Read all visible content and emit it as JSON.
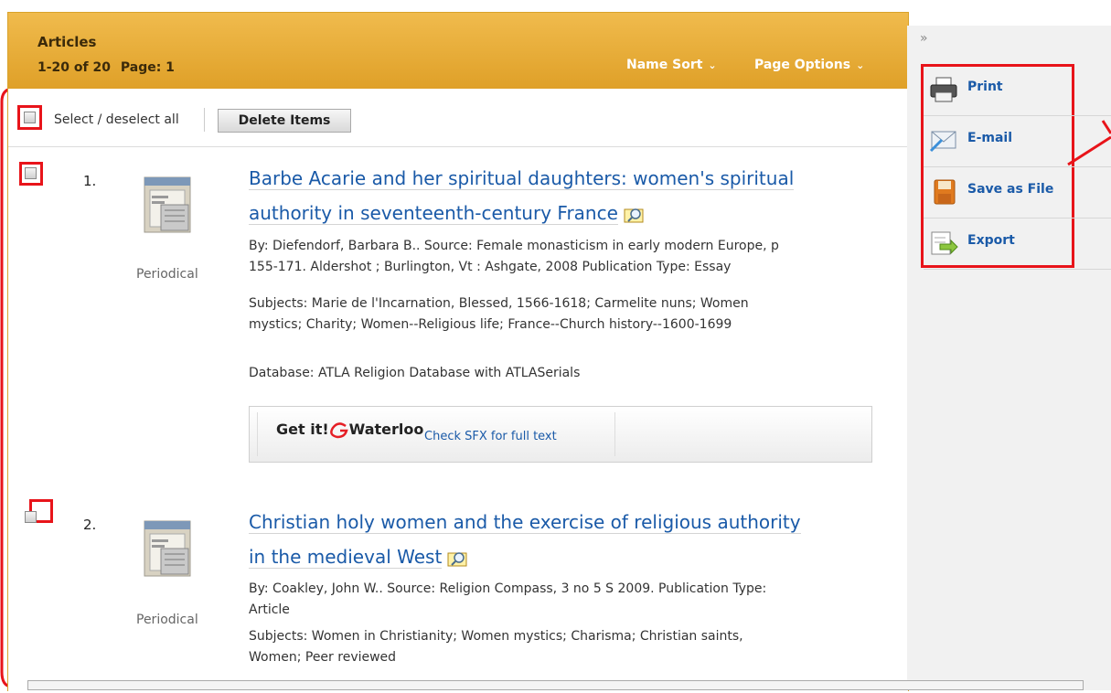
{
  "header": {
    "title": "Articles",
    "range": "1-20 of 20",
    "page": "Page: 1",
    "name_sort": "Name Sort",
    "page_options": "Page Options"
  },
  "toolbar": {
    "select_all": "Select / deselect all",
    "delete_label": "Delete Items"
  },
  "results": [
    {
      "number": "1.",
      "type": "Periodical",
      "title_lines": [
        "Barbe Acarie and her spiritual daughters: women's spiritual",
        "authority in seventeenth-century France"
      ],
      "meta_lines": [
        "By: Diefendorf, Barbara B.. Source: Female monasticism in early modern Europe, p",
        "155-171. Aldershot ; Burlington, Vt : Ashgate, 2008 Publication Type: Essay"
      ],
      "subject_lines": [
        "Subjects: Marie de l'Incarnation, Blessed, 1566-1618; Carmelite nuns; Women",
        "mystics; Charity; Women--Religious life; France--Church history--1600-1699"
      ],
      "database": "Database: ATLA Religion Database with ATLASerials",
      "getit_brand": "Get it!",
      "getit_org": "Waterloo",
      "getit_link": "Check SFX for full text"
    },
    {
      "number": "2.",
      "type": "Periodical",
      "title_lines": [
        "Christian holy women and the exercise of religious authority",
        "in the medieval West"
      ],
      "meta_lines": [
        "By: Coakley, John W.. Source: Religion Compass, 3 no 5 S 2009. Publication Type:",
        "Article"
      ],
      "subject_lines": [
        "Subjects: Women in Christianity; Women mystics; Charisma; Christian saints,",
        "Women; Peer reviewed"
      ]
    }
  ],
  "sidebar": {
    "expand": "»",
    "tools": [
      {
        "label": "Print",
        "icon": "printer-icon"
      },
      {
        "label": "E-mail",
        "icon": "envelope-icon"
      },
      {
        "label": "Save as File",
        "icon": "floppy-disk-icon"
      },
      {
        "label": "Export",
        "icon": "export-icon"
      }
    ]
  },
  "colors": {
    "header": "#e3a632",
    "link": "#1a5aa8",
    "highlight": "#e8141a"
  }
}
